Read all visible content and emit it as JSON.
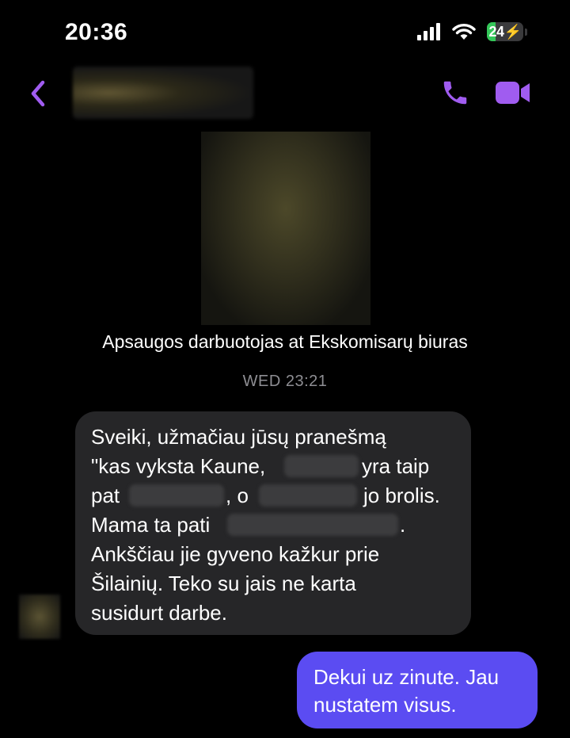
{
  "status_bar": {
    "time": "20:36",
    "battery_level": "24",
    "battery_fraction": 0.24
  },
  "header": {
    "back_icon": "chevron-left-icon",
    "call_icon": "phone-icon",
    "video_icon": "video-camera-icon",
    "accent_color": "#a05cf0"
  },
  "profile": {
    "caption": "Apsaugos darbuotojas at Ekskomisarų biuras"
  },
  "conversation": {
    "timestamp": "WED 23:21"
  },
  "incoming_message": {
    "lines": [
      "Sveiki, užmačiau jūsų pranešmą",
      "\"kas vyksta Kaune,",
      "yra taip",
      "pat",
      ", o",
      "jo brolis.",
      "Mama ta pati",
      ".",
      "Ankščiau jie gyveno kažkur prie",
      "Šilainių. Teko su jais ne karta",
      "susidurt darbe."
    ],
    "bubble_color": "#262628"
  },
  "outgoing_message": {
    "lines": [
      "Dekui uz zinute. Jau",
      "nustatem visus."
    ],
    "bubble_color": "#5b4cf2"
  }
}
